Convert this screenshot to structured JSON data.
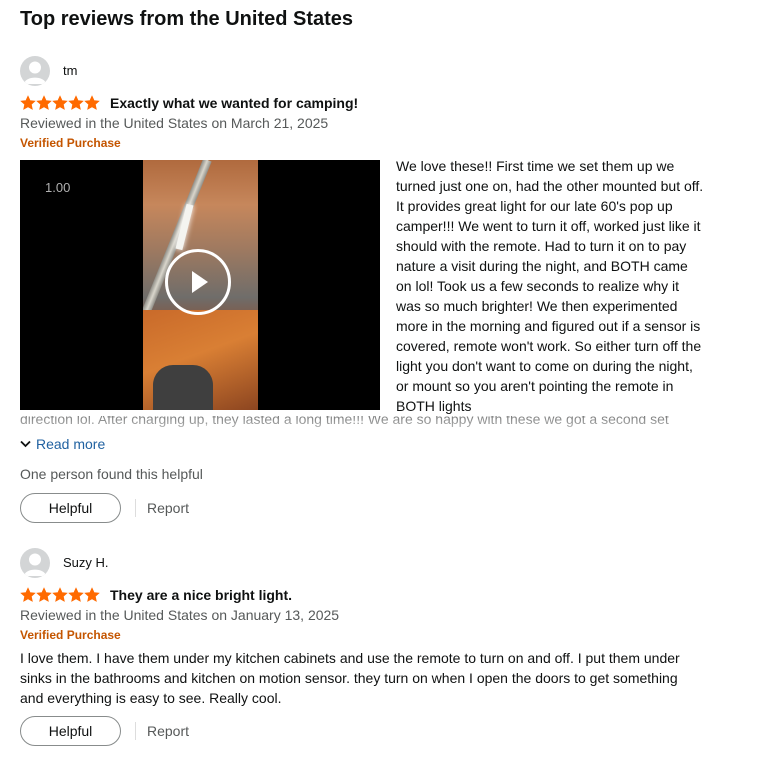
{
  "section": {
    "title": "Top reviews from the United States"
  },
  "colors": {
    "star": "#ff6a00",
    "verified": "#c45500",
    "link": "#2162a1",
    "muted": "#565959"
  },
  "reviews": [
    {
      "author": "tm",
      "rating": 5,
      "rating_max": 5,
      "title": "Exactly what we wanted for camping!",
      "date": "Reviewed in the United States on March 21, 2025",
      "verified": "Verified Purchase",
      "video": {
        "speed": "1.00",
        "play_icon": "play-icon"
      },
      "body": "We love these!! First time we set them up we turned just one on, had the other mounted but off. It provides great light for our late 60's pop up camper!!! We went to turn it off, worked just like it should with the remote. Had to turn it on to pay nature a visit during the night, and BOTH came on lol! Took us a few seconds to realize why it was so much brighter! We then experimented more in the morning and figured out if a sensor is covered, remote won't work. So either turn off the light you don't want to come on during the night, or mount so you aren't pointing the remote in BOTH lights",
      "body_overflow": "direction lol. After charging up, they lasted a long time!!! We are so happy with these we got a second set",
      "read_more": "Read more",
      "helpful_count": "One person found this helpful",
      "helpful_label": "Helpful",
      "report_label": "Report"
    },
    {
      "author": "Suzy H.",
      "rating": 5,
      "rating_max": 5,
      "title": "They are a nice bright light.",
      "date": "Reviewed in the United States on January 13, 2025",
      "verified": "Verified Purchase",
      "body": "I love them. I have them under my kitchen cabinets and use the remote to turn on and off. I put them under sinks in the bathrooms and kitchen on motion sensor. they turn on when I open the doors to get something and everything is easy to see. Really cool.",
      "helpful_label": "Helpful",
      "report_label": "Report"
    }
  ]
}
